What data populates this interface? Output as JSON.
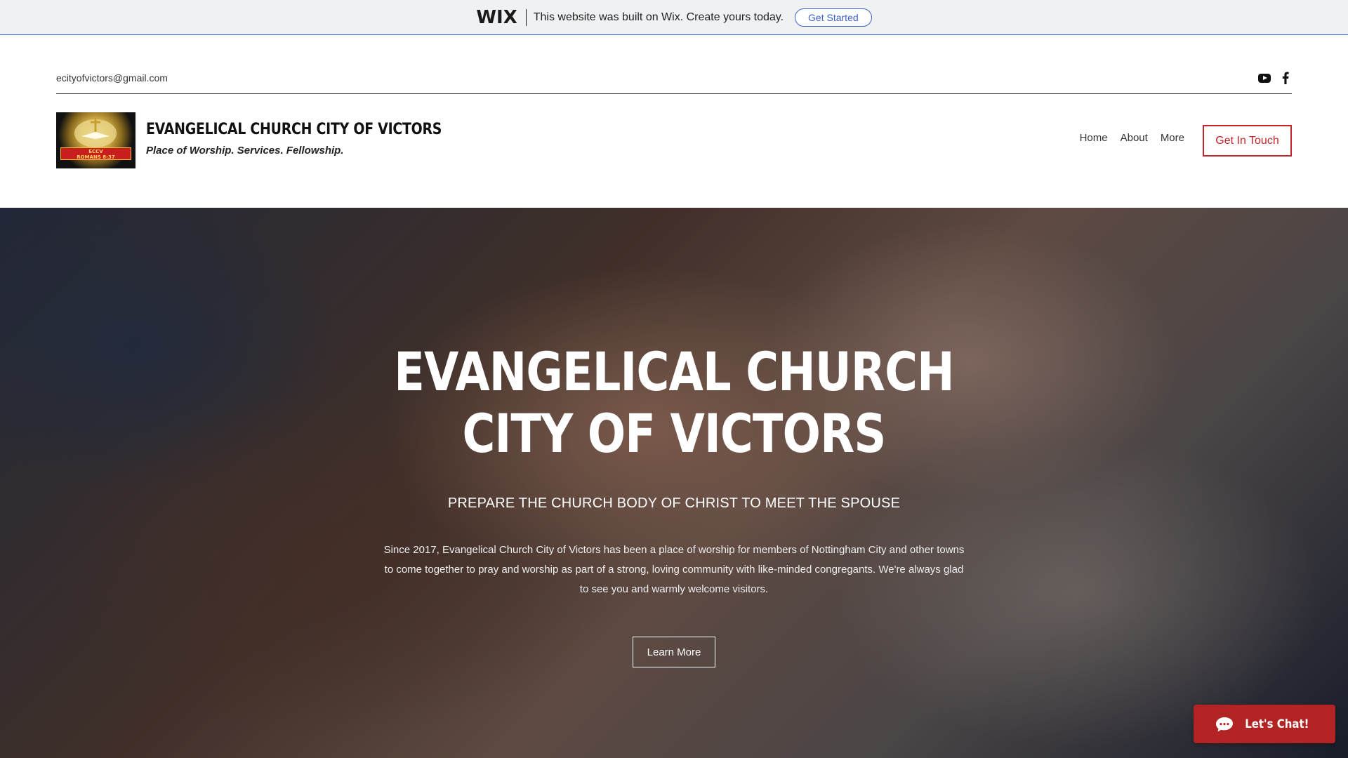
{
  "wix_banner": {
    "logo_text": "WIX",
    "message": "This website was built on Wix. Create yours today.",
    "button_label": "Get Started"
  },
  "topbar": {
    "email": "ecityofvictors@gmail.com",
    "social": [
      "youtube-icon",
      "facebook-icon"
    ]
  },
  "header": {
    "logo_caption": "ECCV\nROMANS 8:37",
    "title": "EVANGELICAL CHURCH CITY OF VICTORS",
    "tagline": "Place of Worship. Services. Fellowship.",
    "nav": [
      "Home",
      "About",
      "More"
    ],
    "cta_label": "Get In Touch"
  },
  "hero": {
    "title": "EVANGELICAL CHURCH CITY OF VICTORS",
    "subtitle": "PREPARE THE CHURCH BODY OF CHRIST TO MEET THE SPOUSE",
    "body": "Since 2017, Evangelical Church City of Victors has been a place of worship for members of Nottingham City and other towns to come together to pray and worship as part of a strong, loving community with like-minded congregants. We're always glad to see you and warmly welcome visitors.",
    "button_label": "Learn More"
  },
  "chat": {
    "label": "Let's Chat!"
  },
  "colors": {
    "accent": "#c4252a",
    "wix_blue": "#3b62c8",
    "chat_bg": "#b22424"
  }
}
